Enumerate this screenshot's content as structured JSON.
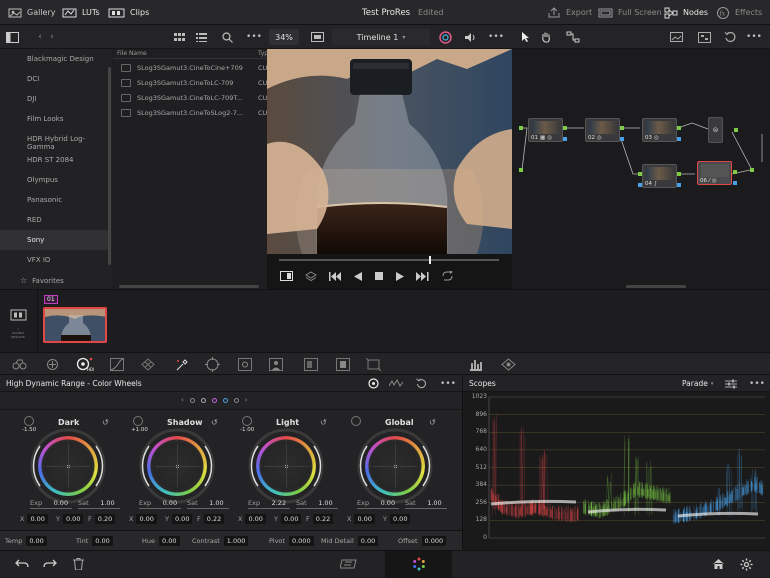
{
  "topbar": {
    "gallery": "Gallery",
    "luts": "LUTs",
    "clips": "Clips",
    "project": "Test ProRes",
    "status": "Edited",
    "export": "Export",
    "fullscreen": "Full Screen",
    "nodes": "Nodes",
    "effects": "Effects"
  },
  "toolbar": {
    "zoom": "34%",
    "timeline": "Timeline 1"
  },
  "sidebar": {
    "items": [
      "Blackmagic Design",
      "DCI",
      "DJI",
      "Film Looks",
      "HDR Hybrid Log-Gamma",
      "HDR ST 2084",
      "Olympus",
      "Panasonic",
      "RED",
      "Sony",
      "VFX IO"
    ],
    "selected": "Sony",
    "favorites": "Favorites"
  },
  "media": {
    "col_name": "File Name",
    "col_type": "Typ",
    "clips": [
      {
        "name": "SLog3SGamut3.CineToCine+709",
        "type": "CU"
      },
      {
        "name": "SLog3SGamut3.CineToLC-709",
        "type": "CU"
      },
      {
        "name": "SLog3SGamut3.CineToLC-709T...",
        "type": "CU"
      },
      {
        "name": "SLog3SGamut3.CineToSLog2-7...",
        "type": "CU"
      }
    ]
  },
  "nodes": [
    {
      "label": "01"
    },
    {
      "label": "02"
    },
    {
      "label": "03"
    },
    {
      "label": "04"
    },
    {
      "label": "06"
    }
  ],
  "timeline": {
    "clip_number": "01",
    "logo_text": "DAVINCI RESOLVE"
  },
  "colorwheels": {
    "title": "High Dynamic Range - Color Wheels",
    "wheels": [
      {
        "name": "Dark",
        "slider": "-1.50",
        "exp": "0.00",
        "sat": "1.00",
        "x": "0.00",
        "y": "0.00",
        "third_label": "F",
        "third": "0.20"
      },
      {
        "name": "Shadow",
        "slider": "+1.00",
        "exp": "0.00",
        "sat": "1.00",
        "x": "0.00",
        "y": "0.00",
        "third_label": "F",
        "third": "0.22"
      },
      {
        "name": "Light",
        "slider": "-1.00",
        "exp": "2.22",
        "sat": "1.00",
        "x": "0.00",
        "y": "0.00",
        "third_label": "F",
        "third": "0.22"
      },
      {
        "name": "Global",
        "slider": "",
        "exp": "0.00",
        "sat": "1.00",
        "x": "0.00",
        "y": "0.00",
        "third_label": "",
        "third": ""
      }
    ],
    "labels": {
      "exp": "Exp",
      "sat": "Sat",
      "x": "X",
      "y": "Y"
    },
    "bottom": [
      {
        "label": "Temp",
        "value": "0.00"
      },
      {
        "label": "Tint",
        "value": "0.00"
      },
      {
        "label": "Hue",
        "value": "0.00"
      },
      {
        "label": "Contrast",
        "value": "1.000"
      },
      {
        "label": "Pivot",
        "value": "0.000"
      },
      {
        "label": "Mid Detail",
        "value": "0.00"
      },
      {
        "label": "Offset",
        "value": "0.000"
      }
    ]
  },
  "scopes": {
    "title": "Scopes",
    "mode": "Parade",
    "ticks": [
      "1023",
      "896",
      "768",
      "640",
      "512",
      "384",
      "256",
      "128",
      "0"
    ]
  },
  "colors": {
    "accent_red": "#e04848",
    "accent_green": "#7ccc46",
    "accent_blue": "#4aa0e6"
  }
}
